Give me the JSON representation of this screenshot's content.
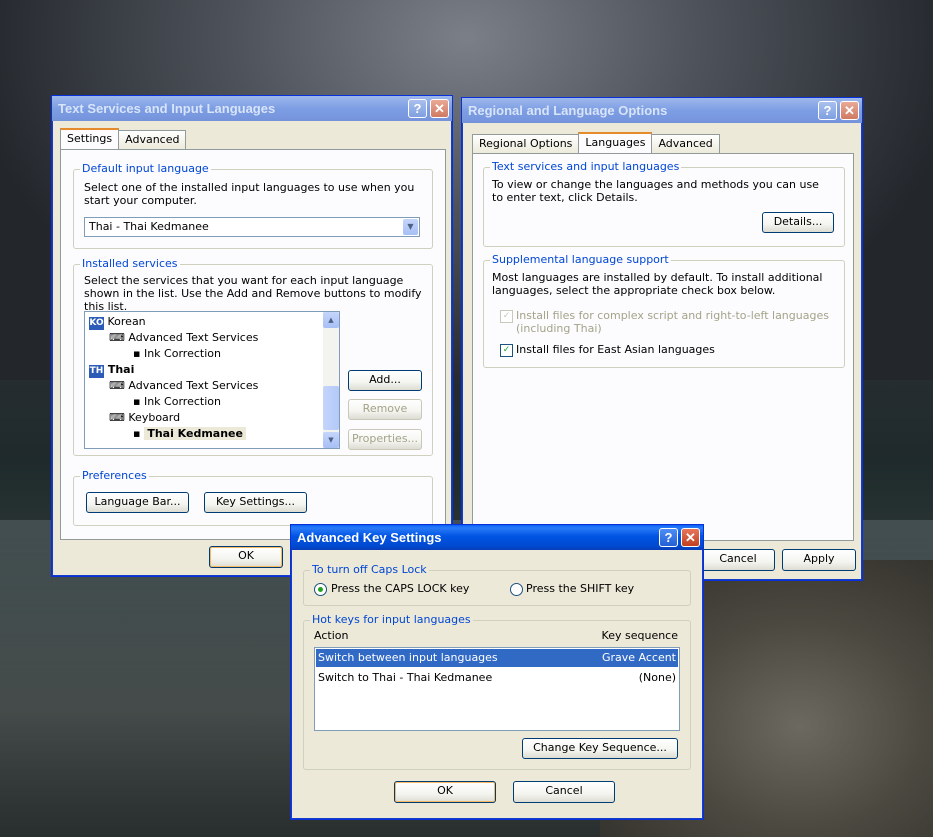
{
  "text_services": {
    "title": "Text Services and Input Languages",
    "tabs": [
      "Settings",
      "Advanced"
    ],
    "default_input": {
      "label": "Default input language",
      "desc": "Select one of the installed input languages to use when you start your computer.",
      "value": "Thai - Thai Kedmanee"
    },
    "installed": {
      "label": "Installed services",
      "desc": "Select the services that you want for each input language shown in the list. Use the Add and Remove buttons to modify this list.",
      "korean_badge": "KO",
      "korean": "Korean",
      "k_ats": "Advanced Text Services",
      "k_ink": "Ink Correction",
      "thai_badge": "TH",
      "thai": "Thai",
      "t_ats": "Advanced Text Services",
      "t_ink": "Ink Correction",
      "keyboard": "Keyboard",
      "kedmanee": "Thai Kedmanee"
    },
    "add": "Add...",
    "remove": "Remove",
    "properties": "Properties...",
    "preferences": "Preferences",
    "language_bar": "Language Bar...",
    "key_settings": "Key Settings...",
    "ok": "OK"
  },
  "regional": {
    "title": "Regional and Language Options",
    "tabs": [
      "Regional Options",
      "Languages",
      "Advanced"
    ],
    "text_services_label": "Text services and input languages",
    "text_services_desc": "To view or change the languages and methods you can use to enter text, click Details.",
    "details": "Details...",
    "supplemental_label": "Supplemental language support",
    "supplemental_desc": "Most languages are installed by default. To install additional languages, select the appropriate check box below.",
    "complex_script": "Install files for complex script and right-to-left languages (including Thai)",
    "east_asian": "Install files for East Asian languages",
    "cancel": "Cancel",
    "apply": "Apply"
  },
  "advanced_keys": {
    "title": "Advanced Key Settings",
    "caps_label": "To turn off Caps Lock",
    "caps_option": "Press the CAPS LOCK key",
    "shift_option": "Press the SHIFT key",
    "hotkeys_label": "Hot keys for input languages",
    "col_action": "Action",
    "col_key": "Key sequence",
    "rows": [
      {
        "action": "Switch between input languages",
        "key": "Grave Accent"
      },
      {
        "action": "Switch to Thai - Thai Kedmanee",
        "key": "(None)"
      }
    ],
    "change": "Change Key Sequence...",
    "ok": "OK",
    "cancel": "Cancel"
  },
  "icons": {
    "help": "?",
    "close": "✕",
    "check": "✓"
  }
}
